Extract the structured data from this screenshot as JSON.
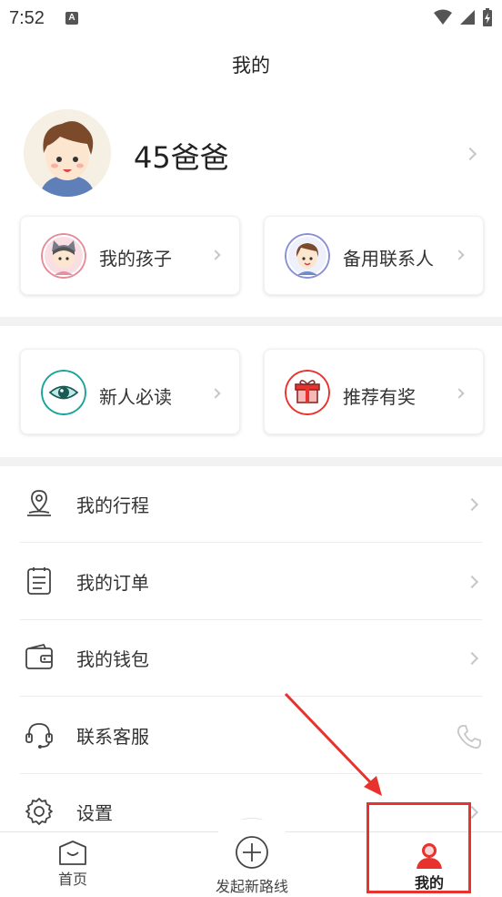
{
  "status_bar": {
    "time": "7:52",
    "notif_letter": "A"
  },
  "header": {
    "title": "我的"
  },
  "profile": {
    "name": "45爸爸"
  },
  "quick_cards": [
    {
      "label": "我的孩子",
      "icon": "child-avatar-icon"
    },
    {
      "label": "备用联系人",
      "icon": "contact-avatar-icon"
    }
  ],
  "feature_cards": [
    {
      "label": "新人必读",
      "icon": "eye-icon"
    },
    {
      "label": "推荐有奖",
      "icon": "gift-icon"
    }
  ],
  "menu": [
    {
      "label": "我的行程",
      "icon": "location-pin-icon"
    },
    {
      "label": "我的订单",
      "icon": "order-list-icon"
    },
    {
      "label": "我的钱包",
      "icon": "wallet-icon"
    },
    {
      "label": "联系客服",
      "icon": "headset-icon"
    },
    {
      "label": "设置",
      "icon": "gear-icon"
    }
  ],
  "tab_bar": {
    "home": "首页",
    "new_route": "发起新路线",
    "mine": "我的"
  },
  "colors": {
    "accent": "#e8322d",
    "teal": "#1aa39a"
  }
}
